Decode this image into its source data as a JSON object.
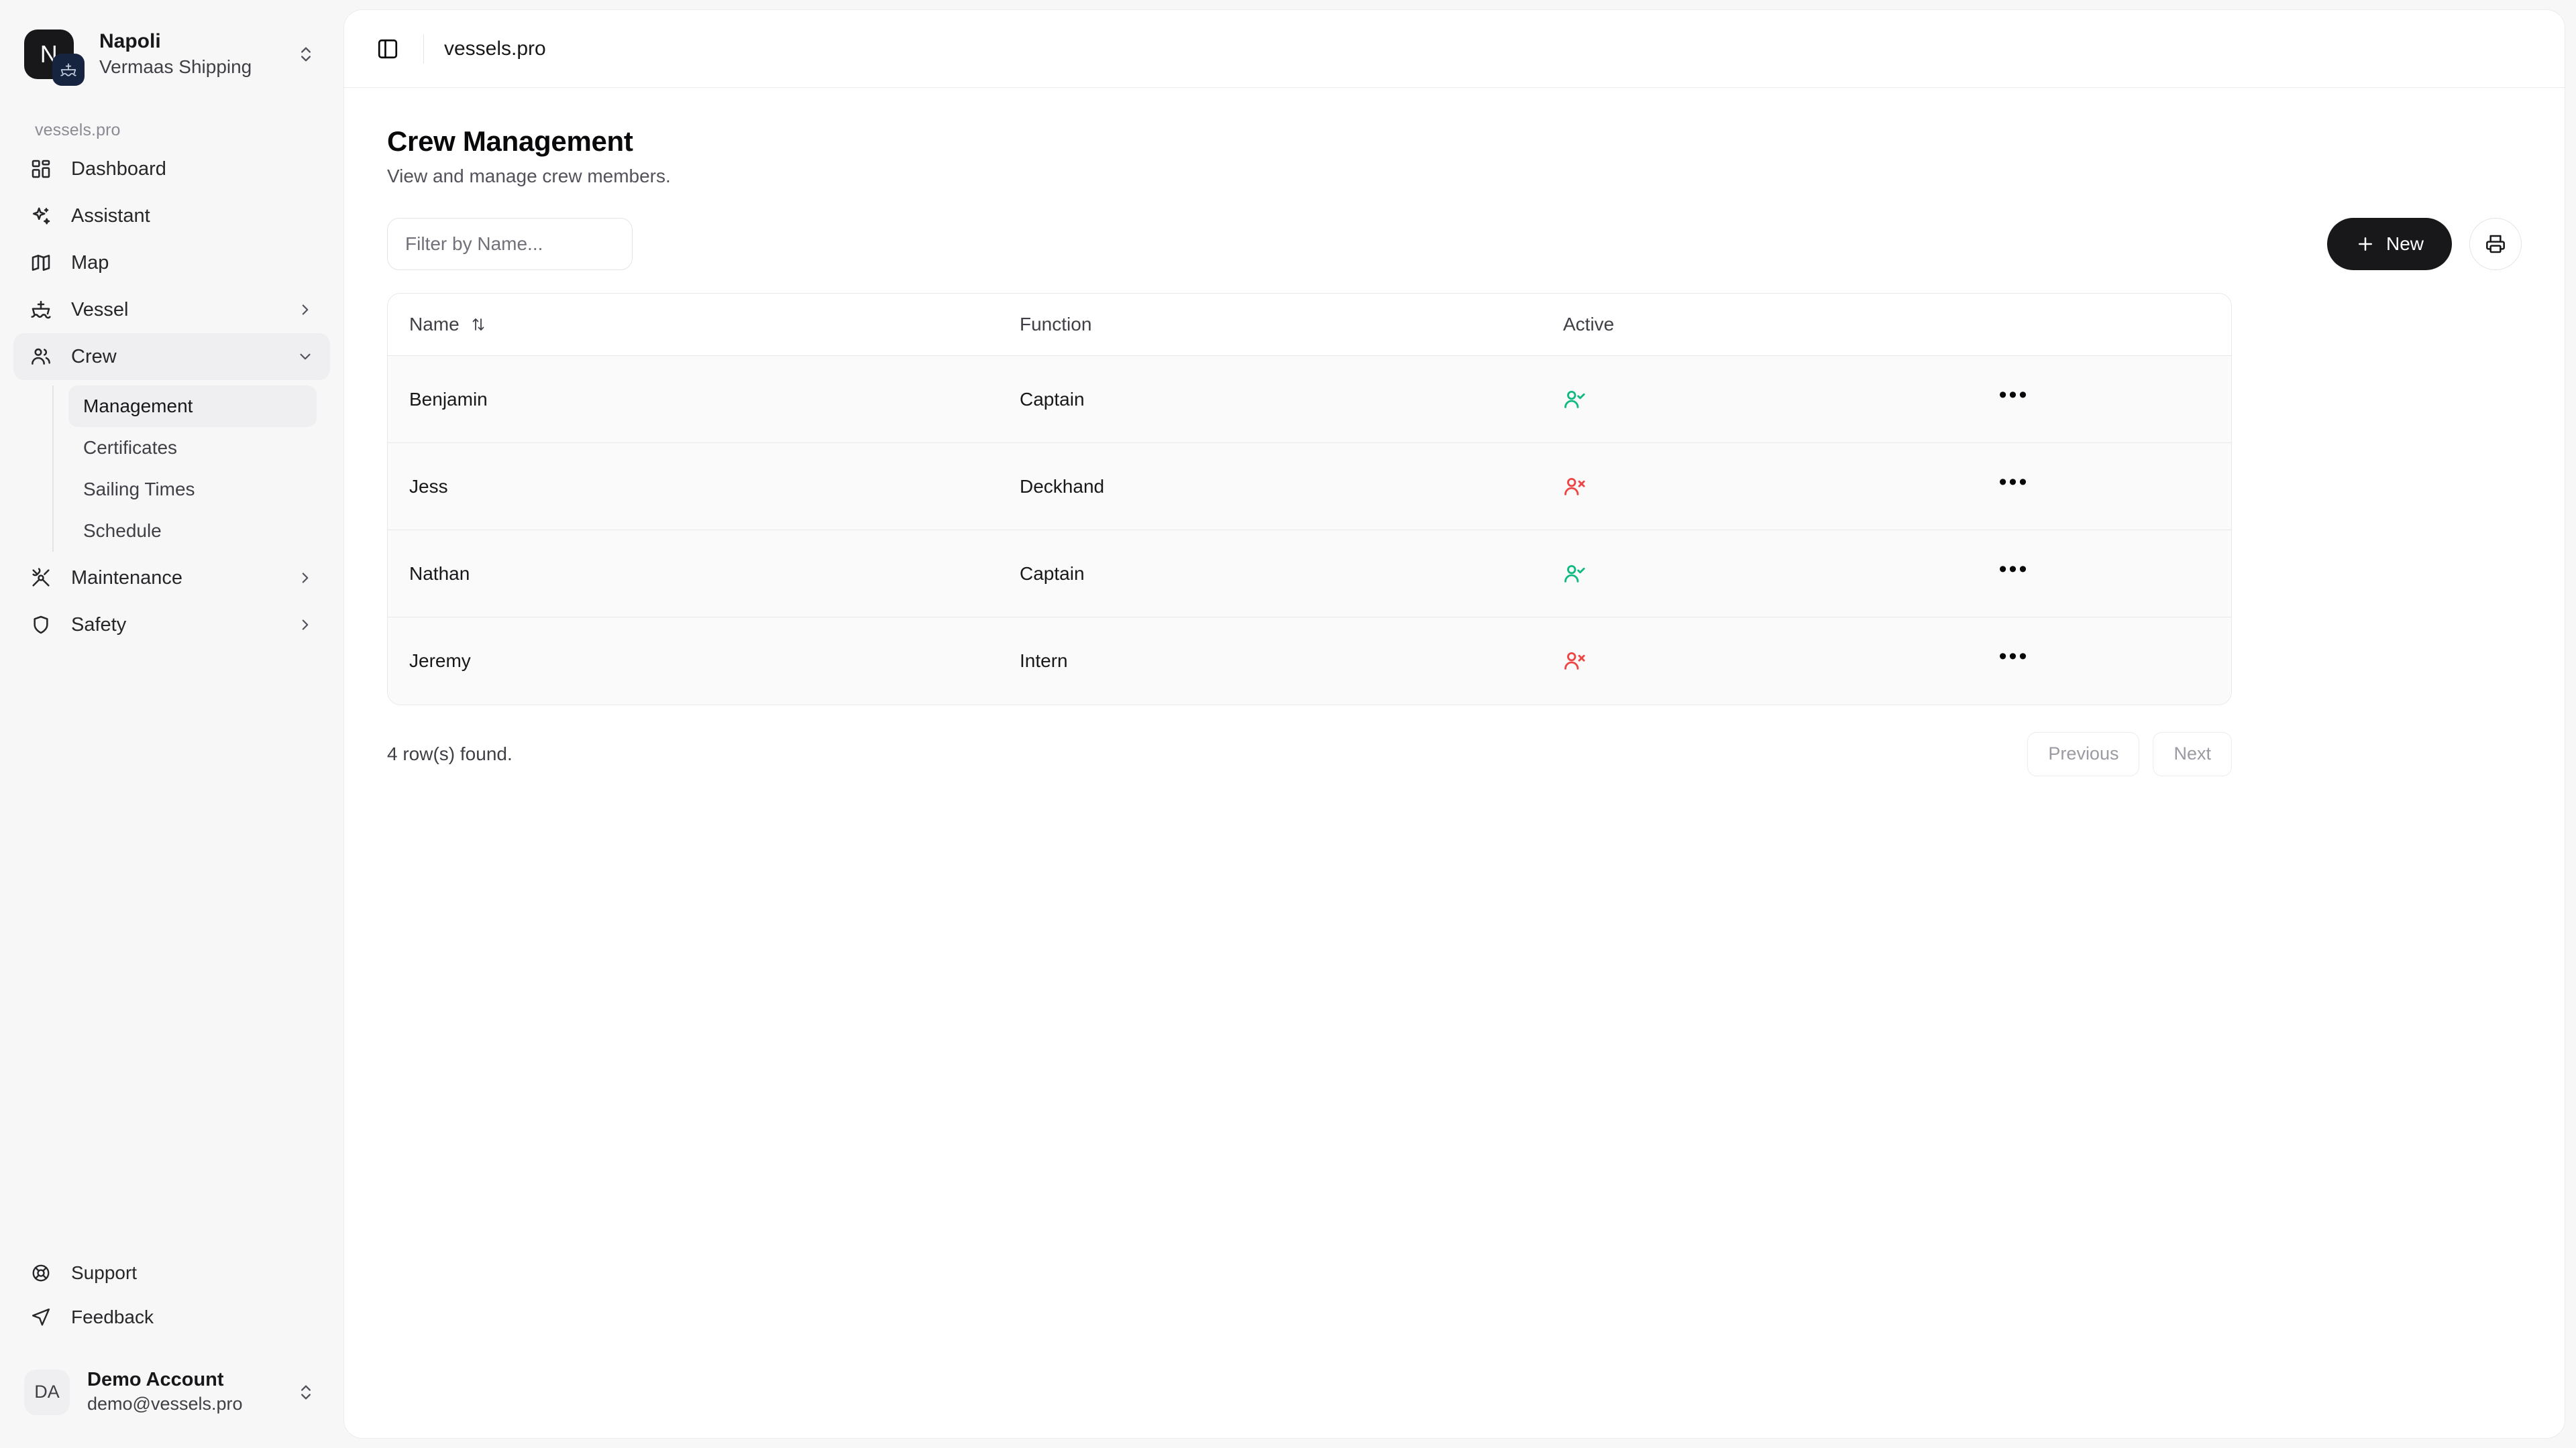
{
  "sidebar": {
    "org": {
      "logo_initial": "N",
      "name": "Napoli",
      "subtitle": "Vermaas Shipping"
    },
    "section_label": "vessels.pro",
    "nav": [
      {
        "label": "Dashboard",
        "icon": "layout-dashboard-icon",
        "expandable": false,
        "active": false
      },
      {
        "label": "Assistant",
        "icon": "sparkles-icon",
        "expandable": false,
        "active": false
      },
      {
        "label": "Map",
        "icon": "map-icon",
        "expandable": false,
        "active": false
      },
      {
        "label": "Vessel",
        "icon": "ship-icon",
        "expandable": true,
        "active": false,
        "expanded": false
      },
      {
        "label": "Crew",
        "icon": "users-icon",
        "expandable": true,
        "active": true,
        "expanded": true
      },
      {
        "label": "Maintenance",
        "icon": "wrench-icon",
        "expandable": true,
        "active": false,
        "expanded": false
      },
      {
        "label": "Safety",
        "icon": "shield-icon",
        "expandable": true,
        "active": false,
        "expanded": false
      }
    ],
    "crew_submenu": [
      {
        "label": "Management",
        "active": true
      },
      {
        "label": "Certificates",
        "active": false
      },
      {
        "label": "Sailing Times",
        "active": false
      },
      {
        "label": "Schedule",
        "active": false
      }
    ],
    "footer_nav": [
      {
        "label": "Support",
        "icon": "life-buoy-icon"
      },
      {
        "label": "Feedback",
        "icon": "send-icon"
      }
    ],
    "account": {
      "initials": "DA",
      "name": "Demo Account",
      "email": "demo@vessels.pro"
    }
  },
  "topbar": {
    "toggle_icon": "panel-left-icon",
    "title": "vessels.pro"
  },
  "page": {
    "title": "Crew Management",
    "description": "View and manage crew members."
  },
  "toolbar": {
    "filter_placeholder": "Filter by Name...",
    "filter_value": "",
    "new_label": "New",
    "new_icon": "plus-icon",
    "print_icon": "printer-icon"
  },
  "table": {
    "columns": [
      {
        "key": "name",
        "label": "Name",
        "sortable": true,
        "sort_icon": "arrow-up-down-icon"
      },
      {
        "key": "function",
        "label": "Function",
        "sortable": false
      },
      {
        "key": "active",
        "label": "Active",
        "sortable": false
      },
      {
        "key": "actions",
        "label": "",
        "sortable": false
      }
    ],
    "rows": [
      {
        "name": "Benjamin",
        "function": "Captain",
        "active": true,
        "active_icon": "user-check-icon",
        "actions_icon": "ellipsis-icon"
      },
      {
        "name": "Jess",
        "function": "Deckhand",
        "active": false,
        "active_icon": "user-x-icon",
        "actions_icon": "ellipsis-icon"
      },
      {
        "name": "Nathan",
        "function": "Captain",
        "active": true,
        "active_icon": "user-check-icon",
        "actions_icon": "ellipsis-icon"
      },
      {
        "name": "Jeremy",
        "function": "Intern",
        "active": false,
        "active_icon": "user-x-icon",
        "actions_icon": "ellipsis-icon"
      }
    ],
    "row_count_text": "4 row(s) found.",
    "pagination": {
      "previous_label": "Previous",
      "next_label": "Next"
    }
  },
  "colors": {
    "active_green": "#10b981",
    "inactive_red": "#ef4444",
    "accent_dark": "#18181b",
    "page_bg": "#f7f7f8",
    "card_bg": "#ffffff"
  }
}
